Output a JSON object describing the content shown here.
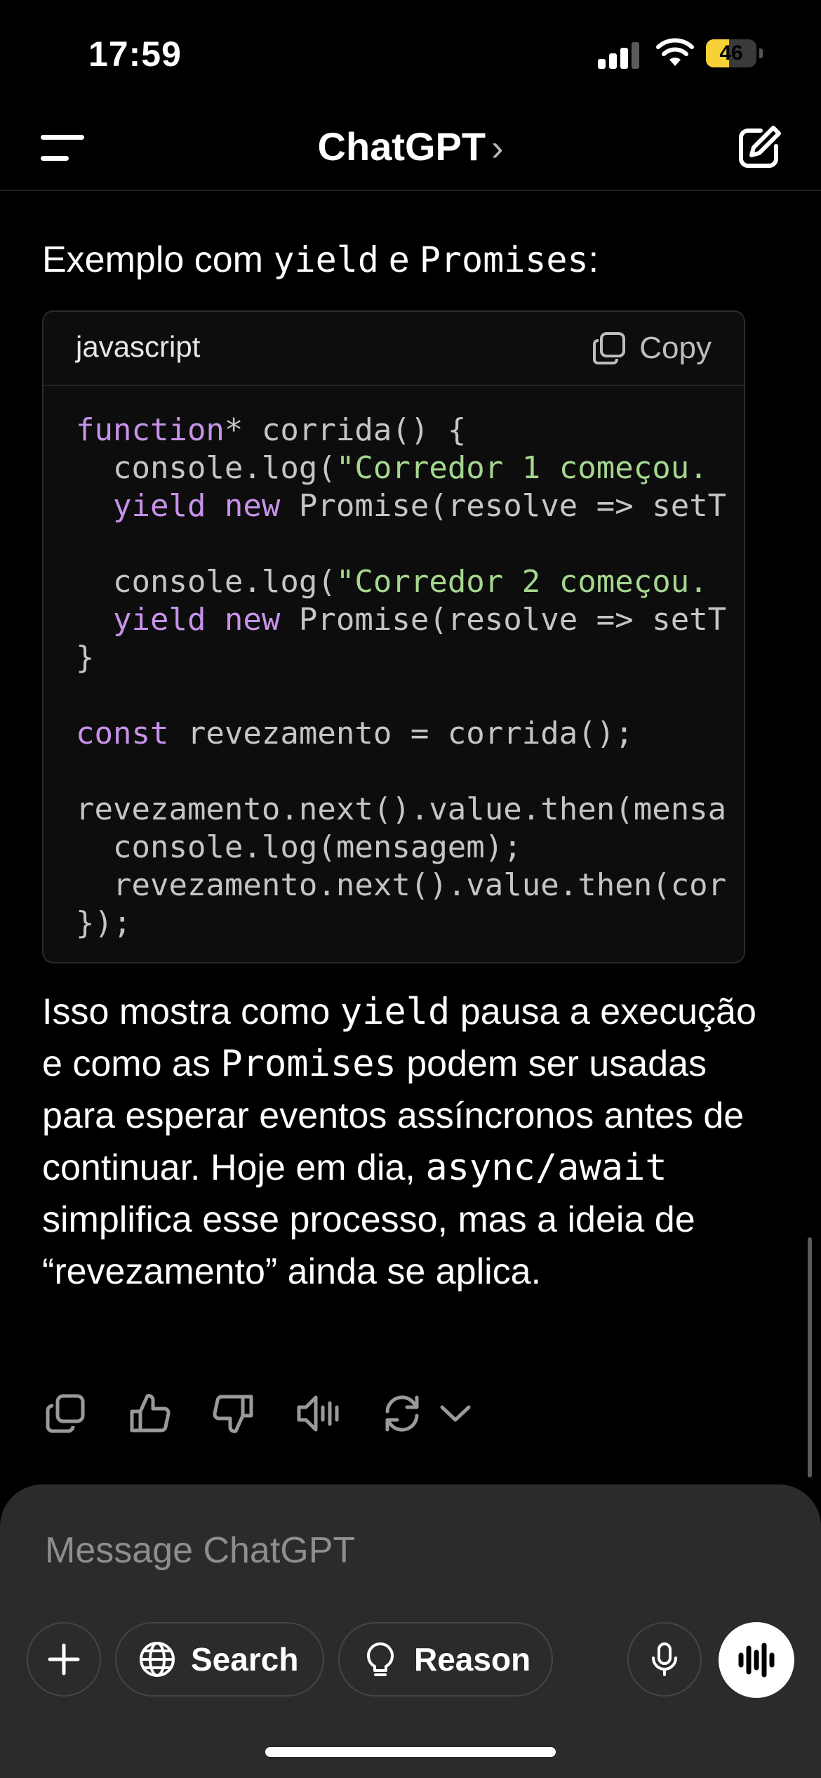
{
  "status_bar": {
    "time": "17:59",
    "battery_percent": "46",
    "battery_level": 0.46,
    "battery_color": "#f7d138"
  },
  "nav": {
    "title": "ChatGPT",
    "chevron": "›"
  },
  "message": {
    "intro_prefix": "Exemplo com ",
    "intro_code1": "yield",
    "intro_middle": " e ",
    "intro_code2": "Promises",
    "intro_suffix": ":",
    "code_block": {
      "language": "javascript",
      "copy_label": "Copy",
      "lines": [
        [
          {
            "t": "kw",
            "v": "function"
          },
          {
            "t": "p",
            "v": "* corrida() {"
          }
        ],
        [
          {
            "t": "p",
            "v": "  console.log("
          },
          {
            "t": "str",
            "v": "\"Corredor 1 começou."
          }
        ],
        [
          {
            "t": "p",
            "v": "  "
          },
          {
            "t": "kw",
            "v": "yield new"
          },
          {
            "t": "p",
            "v": " Promise(resolve => setT"
          }
        ],
        [],
        [
          {
            "t": "p",
            "v": "  console.log("
          },
          {
            "t": "str",
            "v": "\"Corredor 2 começou."
          }
        ],
        [
          {
            "t": "p",
            "v": "  "
          },
          {
            "t": "kw",
            "v": "yield new"
          },
          {
            "t": "p",
            "v": " Promise(resolve => setT"
          }
        ],
        [
          {
            "t": "p",
            "v": "}"
          }
        ],
        [],
        [
          {
            "t": "kw",
            "v": "const"
          },
          {
            "t": "p",
            "v": " revezamento = corrida();"
          }
        ],
        [],
        [
          {
            "t": "p",
            "v": "revezamento.next().value.then(mensa"
          }
        ],
        [
          {
            "t": "p",
            "v": "  console.log(mensagem);"
          }
        ],
        [
          {
            "t": "p",
            "v": "  revezamento.next().value.then(cor"
          }
        ],
        [
          {
            "t": "p",
            "v": "});"
          }
        ]
      ]
    },
    "answer": {
      "p1": "Isso mostra como ",
      "c1": "yield",
      "p2": " pausa a execução e como as ",
      "c2": "Promises",
      "p3": " podem ser usadas para esperar eventos assíncronos antes de continuar. Hoje em dia, ",
      "c3": "async/await",
      "p4": " simplifica esse processo, mas a ideia de “revezamento” ainda se aplica."
    },
    "action_icons": [
      "copy-icon",
      "thumbs-up-icon",
      "thumbs-down-icon",
      "read-aloud-icon",
      "regenerate-icon",
      "chevron-down-icon"
    ]
  },
  "composer": {
    "placeholder": "Message ChatGPT",
    "search_label": "Search",
    "reason_label": "Reason"
  },
  "colors": {
    "keyword": "#c792ea",
    "string": "#a5d68f",
    "background": "#000000",
    "composer": "#2b2b2b"
  }
}
